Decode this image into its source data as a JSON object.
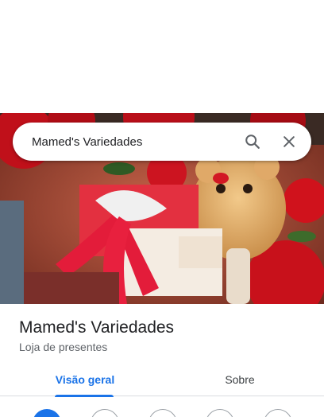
{
  "search": {
    "query": "Mamed's Variedades"
  },
  "place": {
    "name": "Mamed's Variedades",
    "category": "Loja de presentes"
  },
  "tabs": [
    {
      "label": "Visão geral",
      "selected": true
    },
    {
      "label": "Sobre",
      "selected": false
    }
  ],
  "action_buttons": [
    {
      "icon": "directions-icon",
      "primary": true
    },
    {
      "icon": "save-icon",
      "primary": false
    },
    {
      "icon": "nearby-icon",
      "primary": false
    },
    {
      "icon": "send-to-phone-icon",
      "primary": false
    },
    {
      "icon": "share-icon",
      "primary": false
    }
  ],
  "colors": {
    "accent": "#1a73e8",
    "text_primary": "#202124",
    "text_secondary": "#5f6368",
    "divider": "#dadce0"
  }
}
